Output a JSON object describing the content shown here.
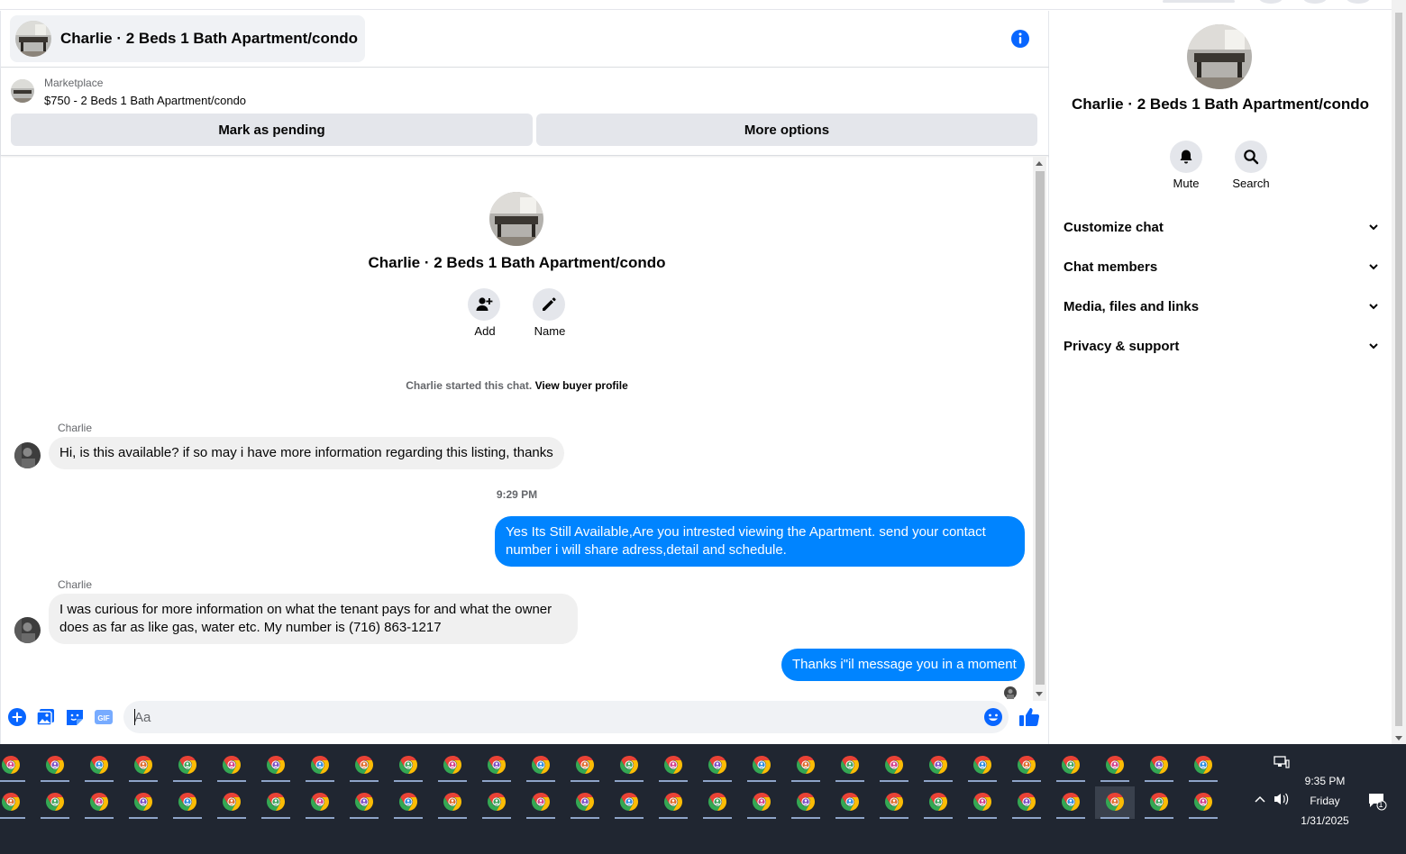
{
  "header": {
    "title": "Charlie · 2 Beds 1 Bath Apartment/condo"
  },
  "marketplace": {
    "label": "Marketplace",
    "listing": "$750 - 2 Beds 1 Bath Apartment/condo",
    "mark_pending": "Mark as pending",
    "more_options": "More options"
  },
  "thread": {
    "name": "Charlie · 2 Beds 1 Bath Apartment/condo",
    "add_label": "Add",
    "name_label": "Name",
    "started_text": "Charlie started this chat.",
    "buyer_profile_link": "View buyer profile",
    "messages": [
      {
        "sender": "Charlie",
        "text": "Hi, is this available? if so may i have more information regarding this listing, thanks"
      },
      {
        "timestamp": "9:29 PM"
      },
      {
        "sender": "me",
        "text": "Yes Its Still Available,Are you intrested viewing the Apartment. send your contact number i will share adress,detail and schedule."
      },
      {
        "sender": "Charlie",
        "text": "I was curious for more information on what the tenant pays for and what the owner does as far as like gas, water etc. My number is (716) 863-1217"
      },
      {
        "sender": "me",
        "text": "Thanks i\"il message you in a moment"
      }
    ]
  },
  "composer": {
    "placeholder": "Aa",
    "icons": [
      "plus-circle-icon",
      "photo-icon",
      "sticker-icon",
      "gif-icon",
      "emoji-icon",
      "like-thumb-icon"
    ]
  },
  "side_panel": {
    "name": "Charlie · 2 Beds 1 Bath Apartment/condo",
    "mute": "Mute",
    "search": "Search",
    "sections": [
      "Customize chat",
      "Chat members",
      "Media, files and links",
      "Privacy & support"
    ]
  },
  "taskbar": {
    "time": "9:35 PM",
    "day": "Friday",
    "date": "1/31/2025",
    "notification_count": "1"
  },
  "colors": {
    "accent": "#0084ff",
    "bubble_in": "#f0f0f0",
    "button_bg": "#e4e6eb",
    "taskbar": "#202631"
  }
}
